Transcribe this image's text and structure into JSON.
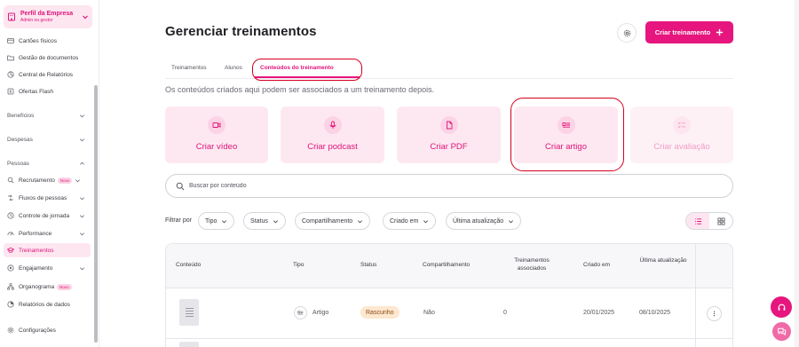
{
  "sidebar": {
    "profile": {
      "title": "Perfil da Empresa",
      "subtitle": "Admin ou gestor"
    },
    "items": [
      {
        "label": "Cartões físicos",
        "icon": "card-icon"
      },
      {
        "label": "Gestão de documentos",
        "icon": "folder-icon"
      },
      {
        "label": "Central de Relatórios",
        "icon": "report-icon"
      },
      {
        "label": "Ofertas Flash",
        "icon": "flash-icon"
      },
      {
        "label": "Benefícios",
        "section": true
      },
      {
        "label": "Despesas",
        "section": true
      },
      {
        "label": "Pessoas",
        "section": true
      },
      {
        "label": "Recrutamento",
        "badge": "Novo",
        "icon": "recruit-icon"
      },
      {
        "label": "Fluxos de pessoas",
        "icon": "flow-icon"
      },
      {
        "label": "Controle de jornada",
        "icon": "clock-icon"
      },
      {
        "label": "Performance",
        "icon": "performance-icon"
      },
      {
        "label": "Treinamentos",
        "icon": "graduation-icon",
        "active": true
      },
      {
        "label": "Engajamento",
        "icon": "engagement-icon"
      },
      {
        "label": "Organograma",
        "badge": "Novo",
        "icon": "org-icon"
      },
      {
        "label": "Relatórios de dados",
        "icon": "chart-icon"
      },
      {
        "label": "Configurações",
        "icon": "settings-icon"
      }
    ]
  },
  "header": {
    "title": "Gerenciar treinamentos",
    "create_button": "Criar treinamento"
  },
  "tabs": [
    {
      "label": "Treinamentos"
    },
    {
      "label": "Alunos"
    },
    {
      "label": "Conteúdos do treinamento",
      "active": true
    }
  ],
  "subtitle": "Os conteúdos criados aqui podem ser associados a um treinamento depois.",
  "cards": [
    {
      "label": "Criar vídeo",
      "icon": "video-icon"
    },
    {
      "label": "Criar podcast",
      "icon": "microphone-icon"
    },
    {
      "label": "Criar PDF",
      "icon": "file-icon"
    },
    {
      "label": "Criar artigo",
      "icon": "article-icon"
    },
    {
      "label": "Criar avaliação",
      "icon": "checklist-icon",
      "disabled": true
    }
  ],
  "search": {
    "placeholder": "Buscar por conteúdo"
  },
  "filters": {
    "label": "Filtrar por",
    "chips": [
      "Tipo",
      "Status",
      "Compartilhamento",
      "Criado em",
      "Última atualização"
    ]
  },
  "table": {
    "columns": [
      "Conteúdo",
      "Tipo",
      "Status",
      "Compartilhamento",
      "Treinamentos associados",
      "Criado em",
      "Última atualização"
    ],
    "rows": [
      {
        "type": "Artigo",
        "status": "Rascunho",
        "shared": "Não",
        "associated": "0",
        "created": "20/01/2025",
        "updated": "08/10/2025"
      }
    ]
  },
  "colors": {
    "accent": "#e6167e",
    "accent_soft": "#fde8f1",
    "status_draft_bg": "#fde7cf",
    "annotation_red": "#d4001f"
  }
}
